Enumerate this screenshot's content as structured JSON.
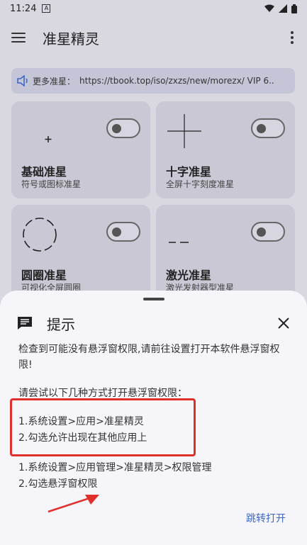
{
  "status_bar": {
    "time": "11:24",
    "notif_icon": "A"
  },
  "app_bar": {
    "title": "准星精灵"
  },
  "notice": {
    "label": "更多准星：",
    "url": "https://tbook.top/iso/zxzs/new/morezx/ VIP 6.."
  },
  "cards": [
    {
      "title": "基础准星",
      "subtitle": "符号或图标准星",
      "enabled": false
    },
    {
      "title": "十字准星",
      "subtitle": "全屏十字刻度准星",
      "enabled": false
    },
    {
      "title": "圆圈准星",
      "subtitle": "可视化全屏圆圈",
      "enabled": false
    },
    {
      "title": "激光准星",
      "subtitle": "激光发射器型准星",
      "enabled": false
    }
  ],
  "dialog": {
    "title": "提示",
    "message1": "检查到可能没有悬浮窗权限,请前往设置打开本软件悬浮窗权限!",
    "message2": "请尝试以下几种方式打开悬浮窗权限：",
    "steps_a": [
      "1.系统设置>应用>准星精灵",
      "2.勾选允许出现在其他应用上"
    ],
    "steps_b": [
      "1.系统设置>应用管理>准星精灵>权限管理",
      "2.勾选悬浮窗权限"
    ],
    "action": "跳转打开"
  },
  "colors": {
    "highlight": "#e0302e",
    "accent": "#3c67c7"
  }
}
